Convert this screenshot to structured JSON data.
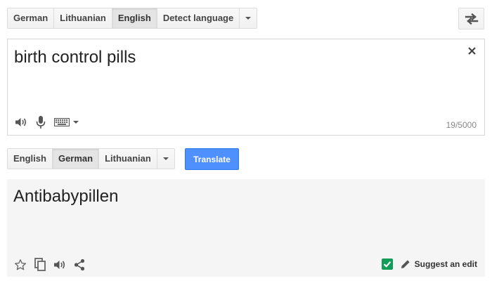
{
  "source_langs": {
    "tabs": [
      "German",
      "Lithuanian",
      "English",
      "Detect language"
    ],
    "selected": 2
  },
  "target_langs": {
    "tabs": [
      "English",
      "German",
      "Lithuanian"
    ],
    "selected": 1
  },
  "source": {
    "text": "birth control pills",
    "char_count": "19/5000"
  },
  "translate_button": "Translate",
  "result": {
    "text": "Antibabypillen",
    "suggest_edit": "Suggest an edit"
  },
  "colors": {
    "accent": "#4d90fe",
    "verified": "#0f9d58"
  },
  "icons": {
    "swap": "swap-icon",
    "clear": "close-icon",
    "listen": "speaker-icon",
    "mic": "microphone-icon",
    "keyboard": "keyboard-icon",
    "star": "star-icon",
    "copy": "copy-icon",
    "share": "share-icon",
    "verified": "verified-shield-icon",
    "edit": "pencil-icon"
  }
}
